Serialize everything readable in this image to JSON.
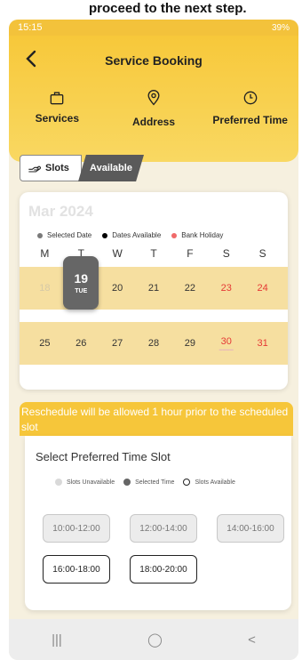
{
  "top_strip": {
    "text": "proceed to the next step."
  },
  "status_bar": {
    "time": "15:15",
    "right": "39%"
  },
  "header": {
    "title": "Service Booking"
  },
  "tabs": [
    {
      "label": "Services",
      "icon": "briefcase-icon"
    },
    {
      "label": "Address",
      "icon": "location-pin-icon"
    },
    {
      "label": "Preferred Time",
      "icon": "clock-icon"
    }
  ],
  "slots_toggle": {
    "left_label": "Slots",
    "right_label": "Available"
  },
  "calendar": {
    "month": "Mar 2024",
    "legend": [
      {
        "label": "Selected Date",
        "color": "#7a7a7a"
      },
      {
        "label": "Dates Available",
        "color": "#000000"
      },
      {
        "label": "Bank Holiday",
        "color": "#f06a6a"
      }
    ],
    "weekdays": [
      "M",
      "T",
      "W",
      "T",
      "F",
      "S",
      "S"
    ],
    "week1": [
      "18",
      "19",
      "20",
      "21",
      "22",
      "23",
      "24"
    ],
    "selected_sub": "TUE",
    "week2": [
      "25",
      "26",
      "27",
      "28",
      "29",
      "30",
      "31"
    ]
  },
  "notice": "Reschedule will be allowed 1 hour prior to the scheduled slot",
  "time_slots": {
    "title": "Select Preferred Time Slot",
    "legend": [
      "Slots Unavailable",
      "Selected Time",
      "Slots Available"
    ],
    "slots": [
      "10:00-12:00",
      "12:00-14:00",
      "14:00-16:00",
      "16:00-18:00",
      "18:00-20:00"
    ]
  },
  "nav": {
    "recents": "|||",
    "home": "◯",
    "back": "<"
  },
  "colors": {
    "accent": "#f7c83a",
    "holiday": "#e53935",
    "selected": "#666666"
  }
}
